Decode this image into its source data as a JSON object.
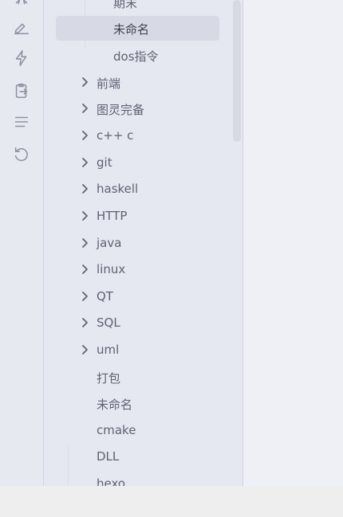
{
  "ribbon": {
    "icons": [
      "collapse-icon",
      "pen-icon",
      "lightning-icon",
      "clipboard-export-icon",
      "list-icon",
      "undo-icon"
    ]
  },
  "tree": {
    "items": [
      {
        "label": "期末",
        "level": "sub",
        "has_children": false,
        "selected": false
      },
      {
        "label": "未命名",
        "level": "sub",
        "has_children": false,
        "selected": true
      },
      {
        "label": "dos指令",
        "level": "sub",
        "has_children": false,
        "selected": false
      },
      {
        "label": "前端",
        "level": "top",
        "has_children": true,
        "selected": false
      },
      {
        "label": "图灵完备",
        "level": "top",
        "has_children": true,
        "selected": false
      },
      {
        "label": "c++ c",
        "level": "top",
        "has_children": true,
        "selected": false
      },
      {
        "label": "git",
        "level": "top",
        "has_children": true,
        "selected": false
      },
      {
        "label": "haskell",
        "level": "top",
        "has_children": true,
        "selected": false
      },
      {
        "label": "HTTP",
        "level": "top",
        "has_children": true,
        "selected": false
      },
      {
        "label": "java",
        "level": "top",
        "has_children": true,
        "selected": false
      },
      {
        "label": "linux",
        "level": "top",
        "has_children": true,
        "selected": false
      },
      {
        "label": "QT",
        "level": "top",
        "has_children": true,
        "selected": false
      },
      {
        "label": "SQL",
        "level": "top",
        "has_children": true,
        "selected": false
      },
      {
        "label": "uml",
        "level": "top",
        "has_children": true,
        "selected": false
      },
      {
        "label": "打包",
        "level": "top",
        "has_children": false,
        "selected": false
      },
      {
        "label": "未命名",
        "level": "top",
        "has_children": false,
        "selected": false
      },
      {
        "label": "cmake",
        "level": "top",
        "has_children": false,
        "selected": false
      },
      {
        "label": "DLL",
        "level": "top",
        "has_children": false,
        "selected": false
      },
      {
        "label": "hexo",
        "level": "top",
        "has_children": false,
        "selected": false
      }
    ]
  }
}
